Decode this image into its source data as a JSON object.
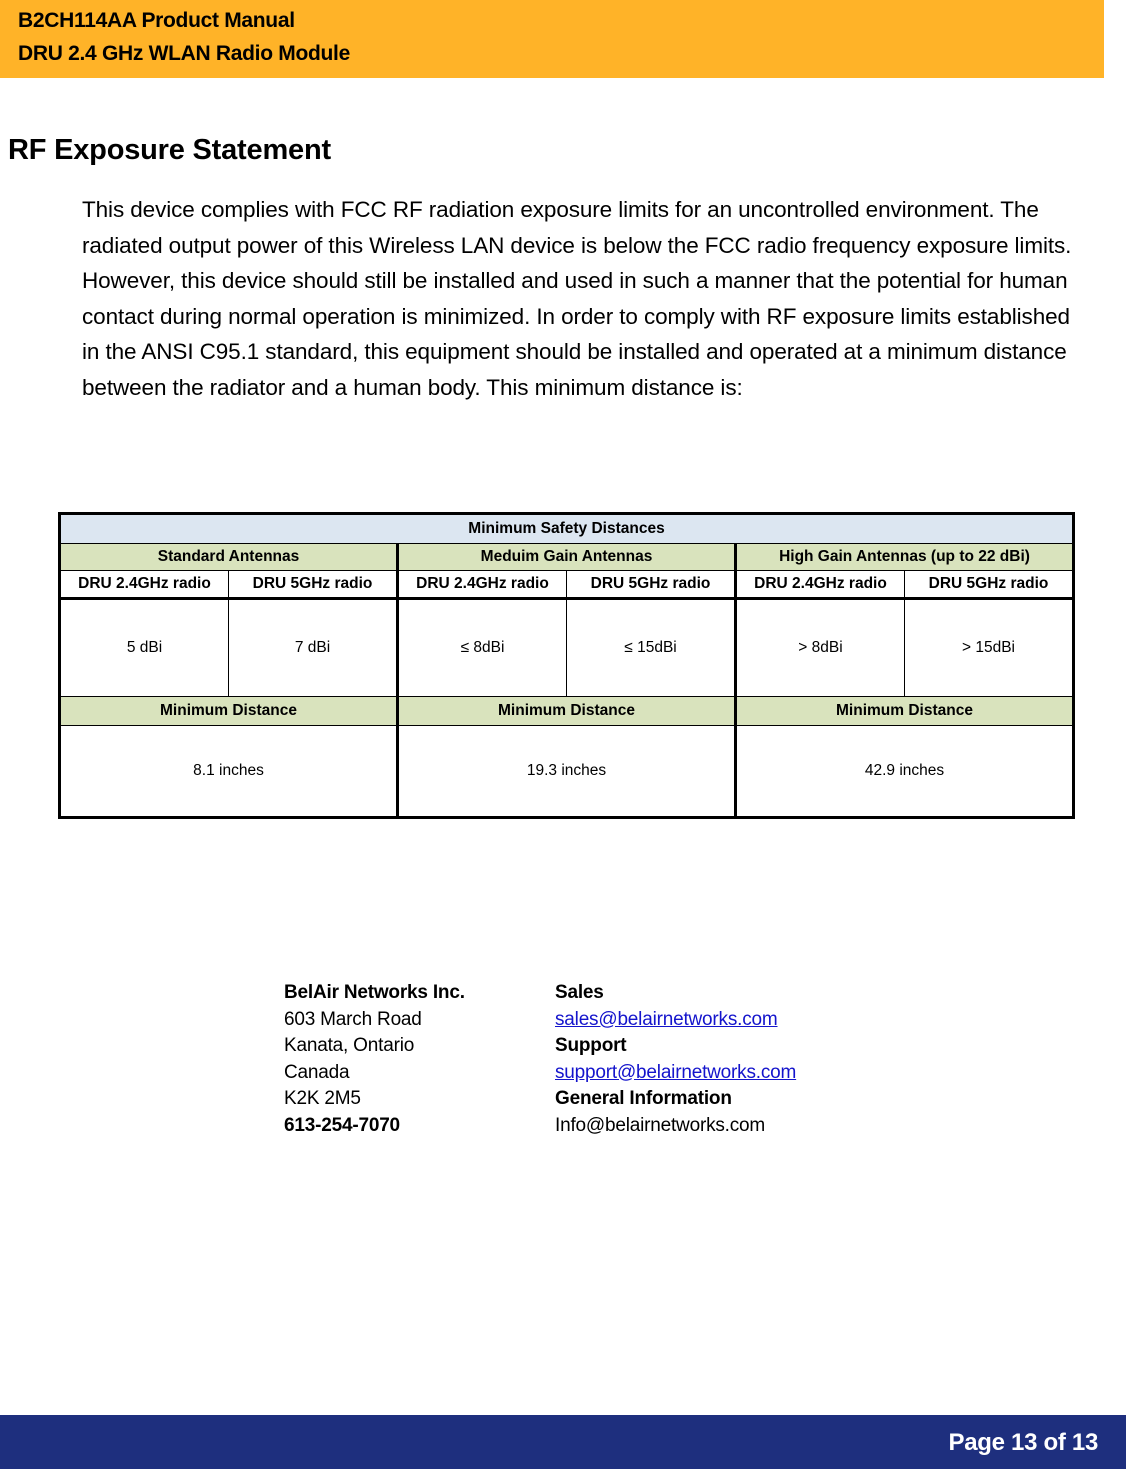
{
  "header": {
    "line1": "B2CH114AA Product Manual",
    "line2": "DRU 2.4 GHz WLAN Radio Module",
    "background_color": "#ffb328"
  },
  "section": {
    "title": "RF Exposure Statement",
    "paragraph": "This device complies with FCC RF radiation exposure limits for an uncontrolled environment.  The radiated output power of this Wireless LAN device is below the FCC radio frequency exposure limits.  However, this device should still be installed and used in such a manner that the potential for human contact during normal operation is minimized.  In order to comply with RF exposure limits established in the ANSI C95.1 standard, this equipment should be installed and operated at a minimum distance between the radiator and a human body.  This minimum distance is:"
  },
  "table": {
    "title": "Minimum Safety Distances",
    "title_background": "#dce6f1",
    "group_background": "#d9e3bd",
    "groups": [
      "Standard Antennas",
      "Meduim Gain Antennas",
      "High Gain Antennas (up to 22 dBi)"
    ],
    "subheaders": [
      "DRU 2.4GHz radio",
      "DRU 5GHz radio",
      "DRU 2.4GHz radio",
      "DRU 5GHz radio",
      "DRU 2.4GHz radio",
      "DRU 5GHz radio"
    ],
    "gains": [
      "5 dBi",
      "7 dBi",
      "≤ 8dBi",
      "≤ 15dBi",
      "> 8dBi",
      "> 15dBi"
    ],
    "min_distance_labels": [
      "Minimum Distance",
      "Minimum Distance",
      "Minimum Distance"
    ],
    "distances": [
      "8.1 inches",
      "19.3 inches",
      "42.9 inches"
    ]
  },
  "contact": {
    "left": {
      "company": "BelAir Networks Inc.",
      "street": "603 March Road",
      "city": "Kanata, Ontario",
      "country": "Canada",
      "postal": "K2K 2M5",
      "phone": "613-254-7070"
    },
    "right": {
      "sales_label": "Sales",
      "sales_email": "sales@belairnetworks.com",
      "support_label": "Support",
      "support_email": "support@belairnetworks.com",
      "general_label": "General Information",
      "general_email": "Info@belairnetworks.com",
      "link_color": "#1414cc"
    }
  },
  "footer": {
    "page_text": "Page 13 of 13",
    "background_color": "#1e2f7e",
    "text_color": "#ffffff"
  }
}
